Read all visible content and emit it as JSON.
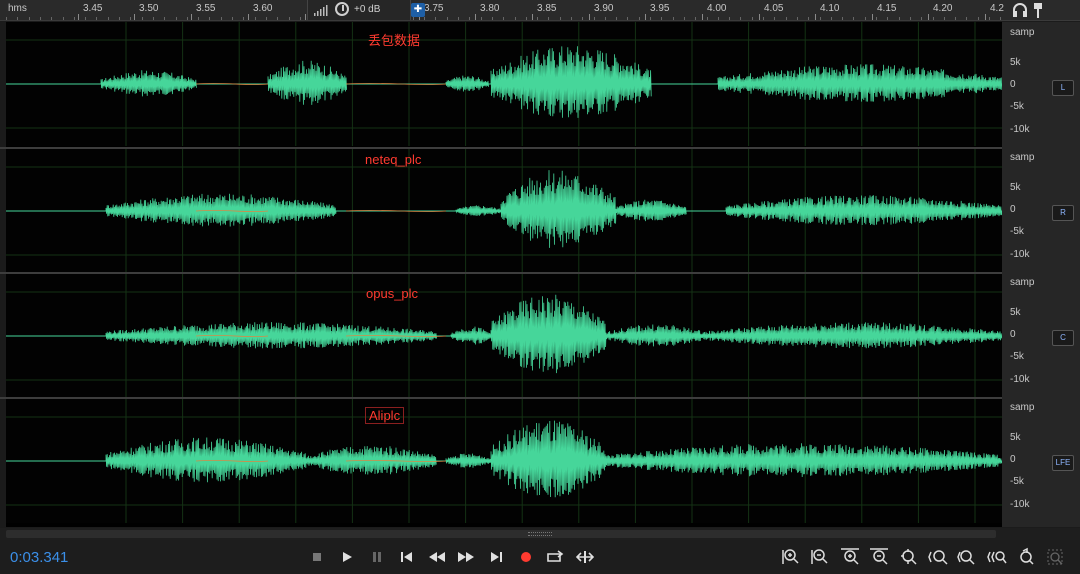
{
  "ruler": {
    "unit": "hms",
    "ticks": [
      "3.45",
      "3.50",
      "3.55",
      "3.60",
      "3.75",
      "3.80",
      "3.85",
      "3.90",
      "3.95",
      "4.00",
      "4.05",
      "4.10",
      "4.15",
      "4.20",
      "4.2"
    ],
    "gain": "+0 dB"
  },
  "tracks": [
    {
      "label": "丢包数据",
      "channel": "L"
    },
    {
      "label": "neteq_plc",
      "channel": "R"
    },
    {
      "label": "opus_plc",
      "channel": "C"
    },
    {
      "label": "Aliplc",
      "channel": "LFE"
    }
  ],
  "scale": {
    "unit": "samp",
    "labels": [
      "5k",
      "0",
      "-5k",
      "-10k"
    ]
  },
  "transport": {
    "time": "0:03.341",
    "buttons": [
      "stop",
      "play",
      "pause",
      "go-to-start",
      "rewind",
      "fast-forward",
      "go-to-end",
      "record",
      "loop",
      "skip-selection"
    ]
  },
  "zoom": {
    "buttons": [
      "zoom-in-amplitude",
      "zoom-out-amplitude",
      "zoom-in-time",
      "zoom-out-time",
      "zoom-full",
      "zoom-in-left",
      "zoom-in-right",
      "zoom-selection",
      "zoom-reset",
      "zoom-extra"
    ]
  },
  "colors": {
    "waveform": "#46d69a",
    "waveform_dim": "#d68a46",
    "label": "#ff3b30",
    "time": "#3b8fe8",
    "record": "#ff3b30"
  }
}
